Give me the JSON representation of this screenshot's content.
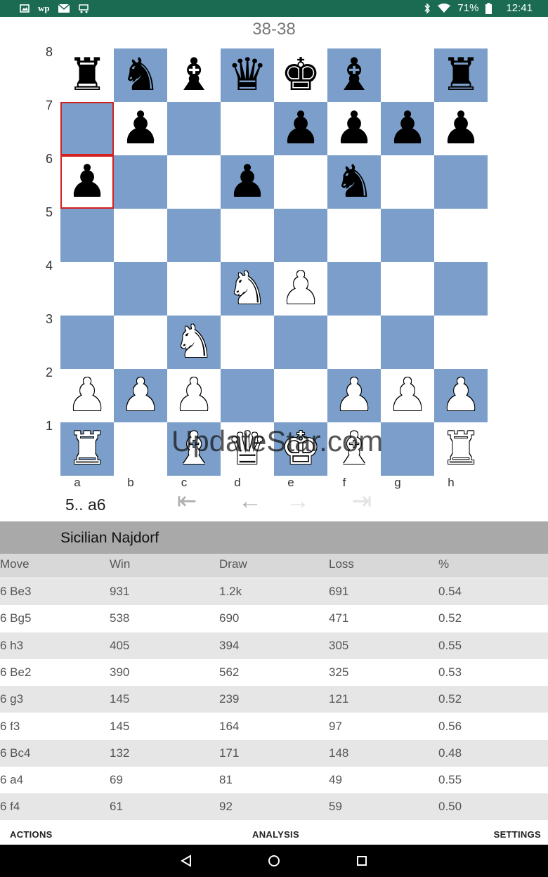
{
  "status_bar": {
    "icons_left": [
      "image-icon",
      "wp-icon",
      "mail-icon",
      "cart-icon"
    ],
    "icons_right": [
      "bluetooth-icon",
      "wifi-icon",
      "battery-icon"
    ],
    "battery": "71%",
    "time": "12:41"
  },
  "score": "38-38",
  "board": {
    "files": [
      "a",
      "b",
      "c",
      "d",
      "e",
      "f",
      "g",
      "h"
    ],
    "ranks": [
      "8",
      "7",
      "6",
      "5",
      "4",
      "3",
      "2",
      "1"
    ],
    "pieces": [
      {
        "sq": "a8",
        "color": "black",
        "type": "rook",
        "glyph": "♜"
      },
      {
        "sq": "b8",
        "color": "black",
        "type": "knight",
        "glyph": "♞"
      },
      {
        "sq": "c8",
        "color": "black",
        "type": "bishop",
        "glyph": "♝"
      },
      {
        "sq": "d8",
        "color": "black",
        "type": "queen",
        "glyph": "♛"
      },
      {
        "sq": "e8",
        "color": "black",
        "type": "king",
        "glyph": "♚"
      },
      {
        "sq": "f8",
        "color": "black",
        "type": "bishop",
        "glyph": "♝"
      },
      {
        "sq": "h8",
        "color": "black",
        "type": "rook",
        "glyph": "♜"
      },
      {
        "sq": "b7",
        "color": "black",
        "type": "pawn",
        "glyph": "♟"
      },
      {
        "sq": "e7",
        "color": "black",
        "type": "pawn",
        "glyph": "♟"
      },
      {
        "sq": "f7",
        "color": "black",
        "type": "pawn",
        "glyph": "♟"
      },
      {
        "sq": "g7",
        "color": "black",
        "type": "pawn",
        "glyph": "♟"
      },
      {
        "sq": "h7",
        "color": "black",
        "type": "pawn",
        "glyph": "♟"
      },
      {
        "sq": "a6",
        "color": "black",
        "type": "pawn",
        "glyph": "♟"
      },
      {
        "sq": "d6",
        "color": "black",
        "type": "pawn",
        "glyph": "♟"
      },
      {
        "sq": "f6",
        "color": "black",
        "type": "knight",
        "glyph": "♞"
      },
      {
        "sq": "d4",
        "color": "white",
        "type": "knight",
        "glyph": "♞"
      },
      {
        "sq": "e4",
        "color": "white",
        "type": "pawn",
        "glyph": "♟"
      },
      {
        "sq": "c3",
        "color": "white",
        "type": "knight",
        "glyph": "♞"
      },
      {
        "sq": "a2",
        "color": "white",
        "type": "pawn",
        "glyph": "♟"
      },
      {
        "sq": "b2",
        "color": "white",
        "type": "pawn",
        "glyph": "♟"
      },
      {
        "sq": "c2",
        "color": "white",
        "type": "pawn",
        "glyph": "♟"
      },
      {
        "sq": "f2",
        "color": "white",
        "type": "pawn",
        "glyph": "♟"
      },
      {
        "sq": "g2",
        "color": "white",
        "type": "pawn",
        "glyph": "♟"
      },
      {
        "sq": "h2",
        "color": "white",
        "type": "pawn",
        "glyph": "♟"
      },
      {
        "sq": "a1",
        "color": "white",
        "type": "rook",
        "glyph": "♜"
      },
      {
        "sq": "c1",
        "color": "white",
        "type": "bishop",
        "glyph": "♝"
      },
      {
        "sq": "d1",
        "color": "white",
        "type": "queen",
        "glyph": "♛"
      },
      {
        "sq": "e1",
        "color": "white",
        "type": "king",
        "glyph": "♚"
      },
      {
        "sq": "f1",
        "color": "white",
        "type": "bishop",
        "glyph": "♝"
      },
      {
        "sq": "h1",
        "color": "white",
        "type": "rook",
        "glyph": "♜"
      }
    ],
    "highlighted": [
      "a7",
      "a6"
    ],
    "light_color": "#ffffff",
    "dark_color": "#7b9fca",
    "highlight_color": "#d32020"
  },
  "watermark": "UpdateStar.com",
  "last_move": "5.. a6",
  "nav": {
    "first": "⇤",
    "back": "←",
    "forward": "→",
    "last": "⇥"
  },
  "opening": "Sicilian Najdorf",
  "table": {
    "headers": [
      "Move",
      "Win",
      "Draw",
      "Loss",
      "%"
    ],
    "rows": [
      [
        "6 Be3",
        "931",
        "1.2k",
        "691",
        "0.54"
      ],
      [
        "6 Bg5",
        "538",
        "690",
        "471",
        "0.52"
      ],
      [
        "6 h3",
        "405",
        "394",
        "305",
        "0.55"
      ],
      [
        "6 Be2",
        "390",
        "562",
        "325",
        "0.53"
      ],
      [
        "6 g3",
        "145",
        "239",
        "121",
        "0.52"
      ],
      [
        "6 f3",
        "145",
        "164",
        "97",
        "0.56"
      ],
      [
        "6 Bc4",
        "132",
        "171",
        "148",
        "0.48"
      ],
      [
        "6 a4",
        "69",
        "81",
        "49",
        "0.55"
      ],
      [
        "6 f4",
        "61",
        "92",
        "59",
        "0.50"
      ]
    ]
  },
  "actions": {
    "actions": "ACTIONS",
    "analysis": "ANALYSIS",
    "settings": "SETTINGS"
  }
}
